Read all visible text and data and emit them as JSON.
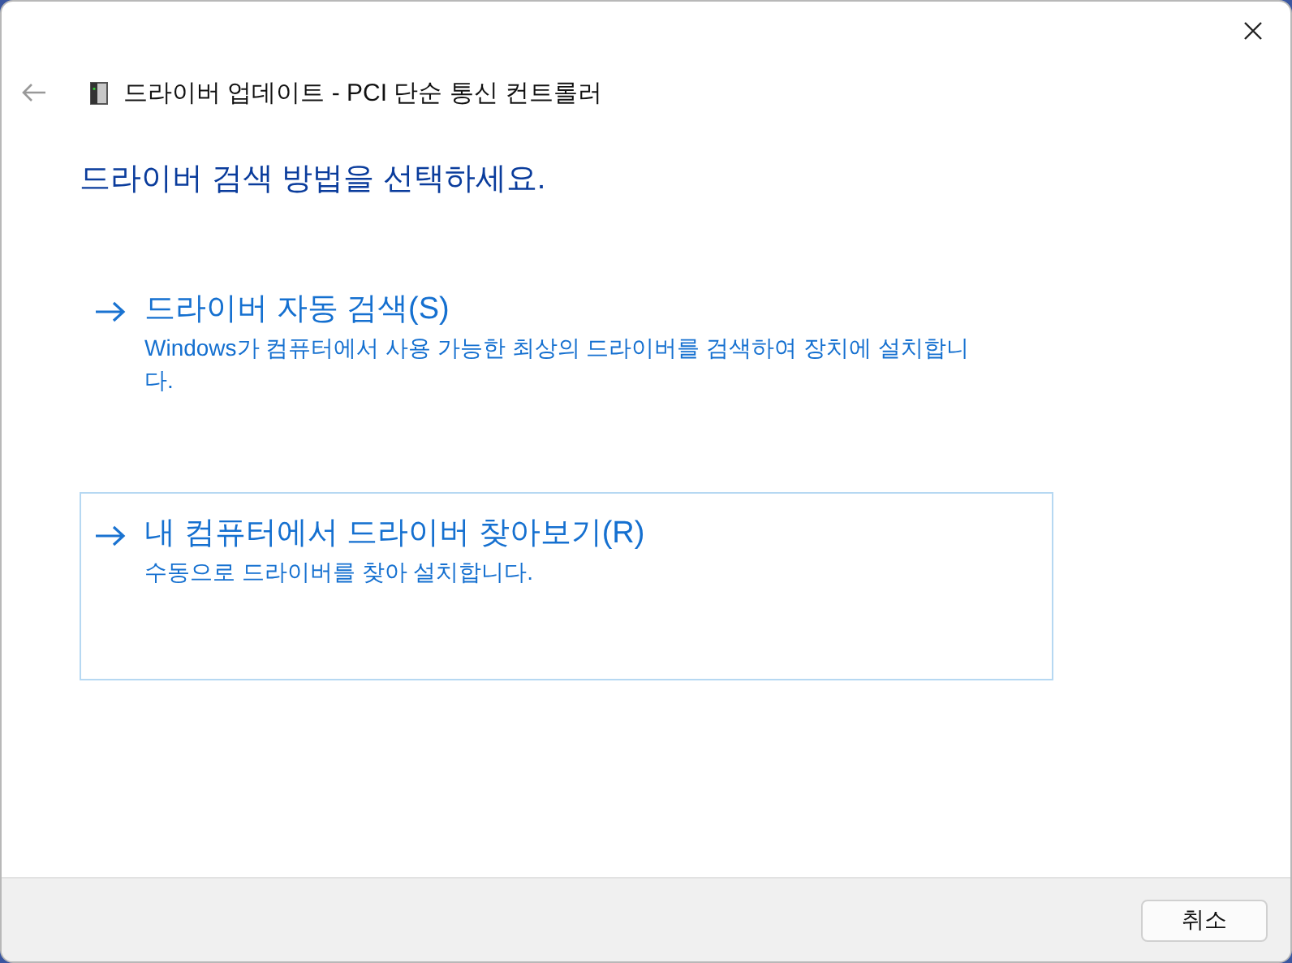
{
  "window": {
    "title": "드라이버 업데이트 - PCI 단순 통신 컨트롤러"
  },
  "heading": "드라이버 검색 방법을 선택하세요.",
  "options": [
    {
      "title": "드라이버 자동 검색(S)",
      "description": "Windows가 컴퓨터에서 사용 가능한 최상의 드라이버를 검색하여 장치에 설치합니다.",
      "selected": false
    },
    {
      "title": "내 컴퓨터에서 드라이버 찾아보기(R)",
      "description": "수동으로 드라이버를 찾아 설치합니다.",
      "selected": true
    }
  ],
  "buttons": [
    "취소"
  ]
}
